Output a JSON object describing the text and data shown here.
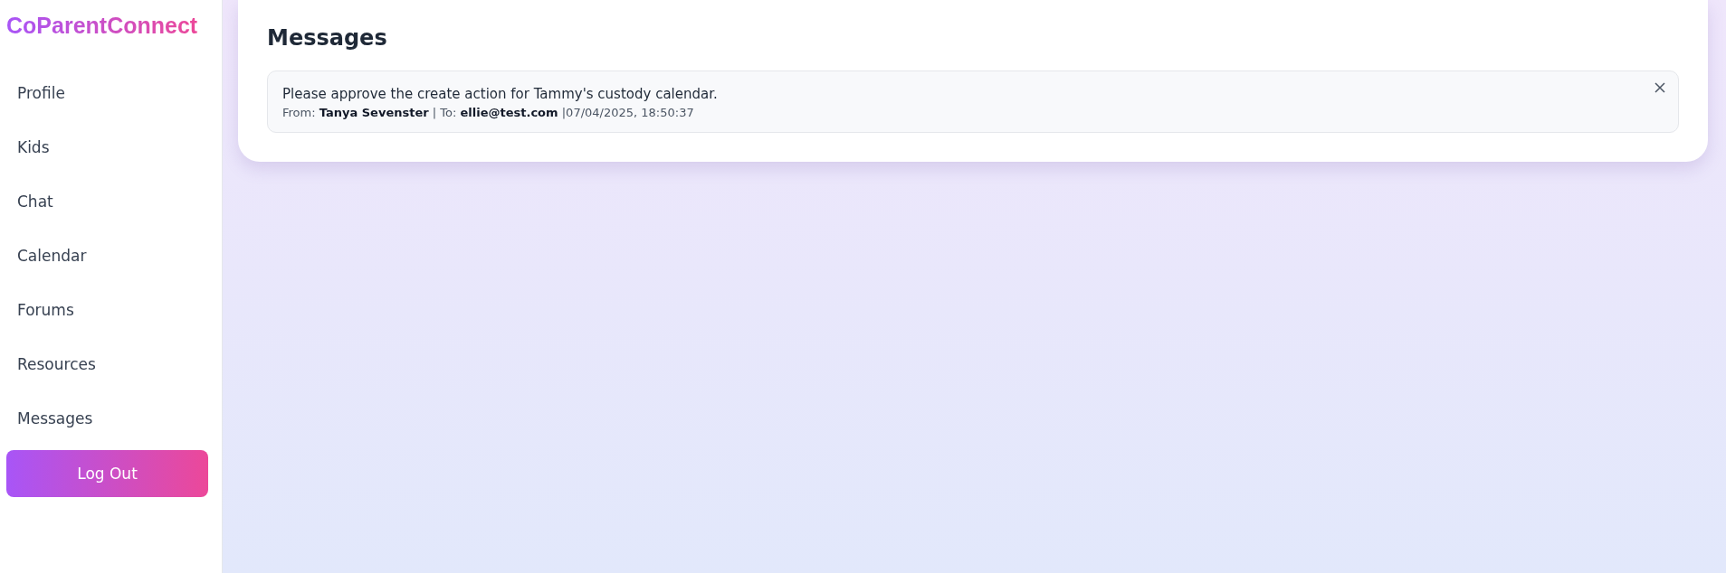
{
  "sidebar": {
    "logo": "CoParentConnect",
    "items": [
      {
        "label": "Profile"
      },
      {
        "label": "Kids"
      },
      {
        "label": "Chat"
      },
      {
        "label": "Calendar"
      },
      {
        "label": "Forums"
      },
      {
        "label": "Resources"
      },
      {
        "label": "Messages"
      }
    ],
    "logout_button": "Log Out"
  },
  "main": {
    "title": "Messages",
    "messages": [
      {
        "text": "Please approve the create action for Tammy's custody calendar.",
        "meta": "From: **Tanya Sevenster** | To: **ellie@test.com** |07/04/2025, 18:50:37"
      }
    ]
  }
}
